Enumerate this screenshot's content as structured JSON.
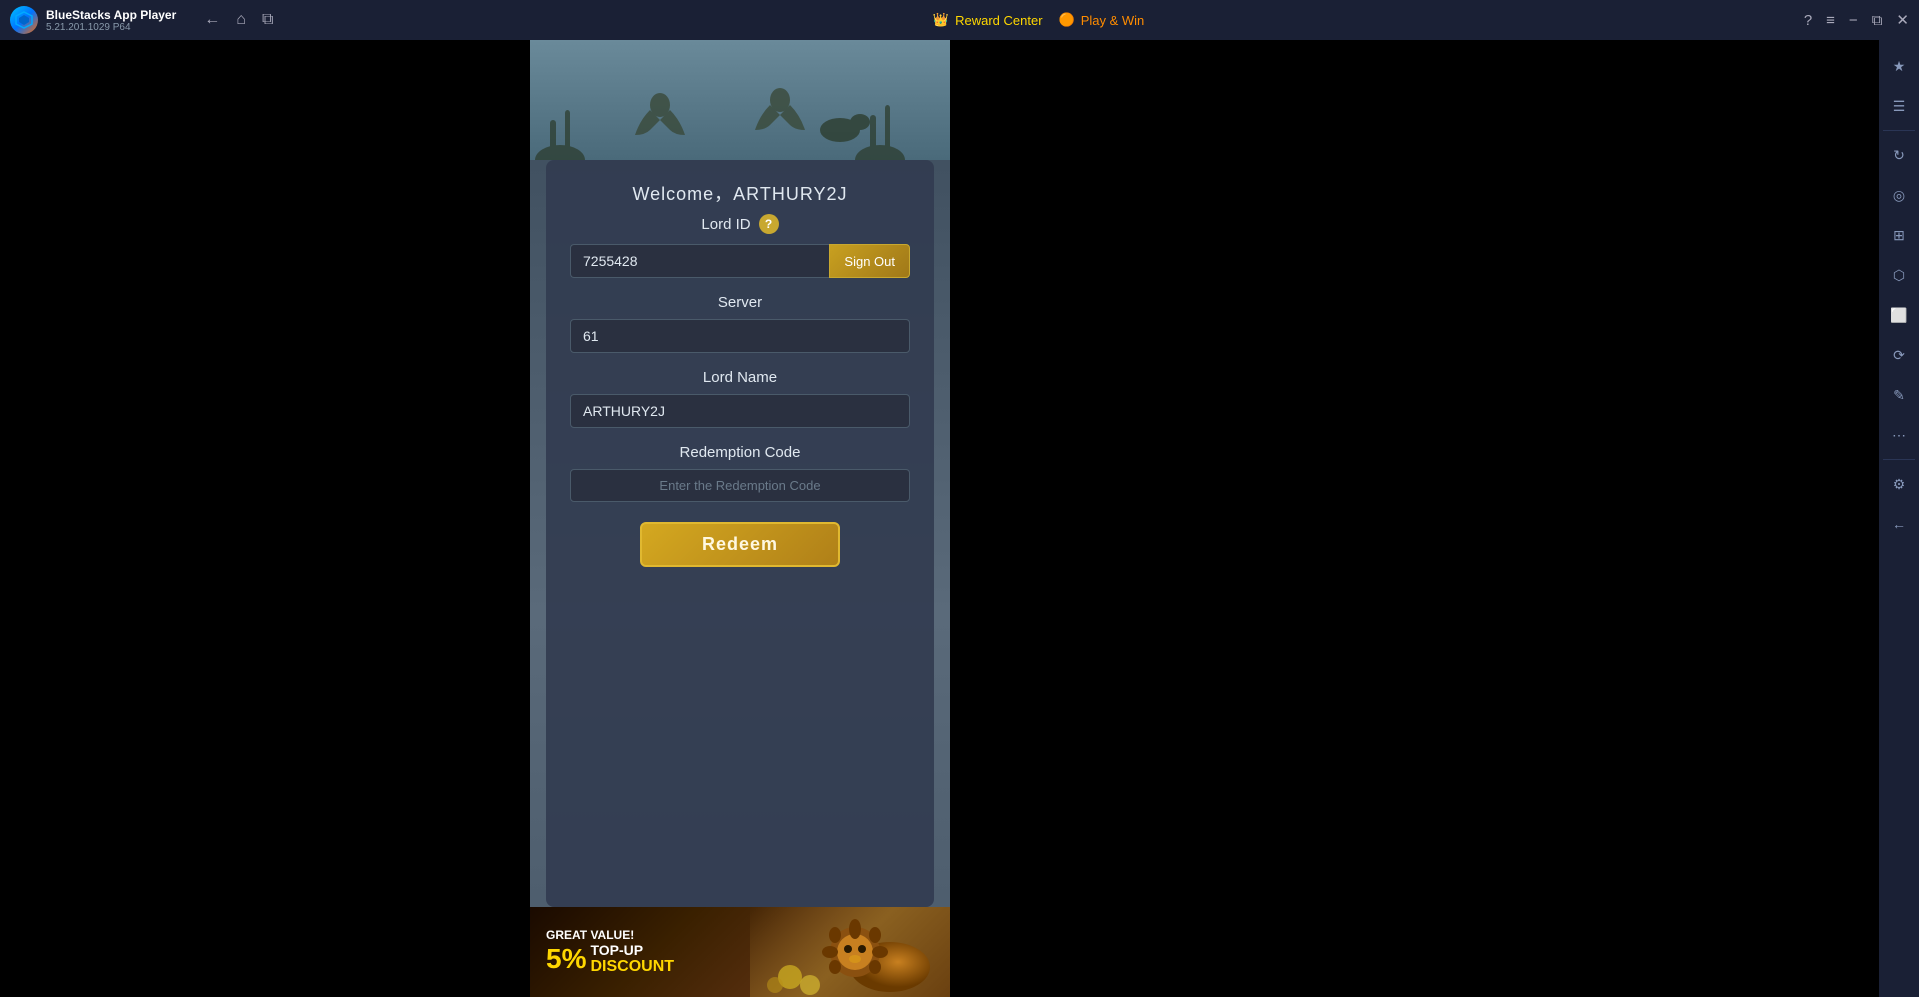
{
  "titleBar": {
    "appName": "BlueStacks App Player",
    "version": "5.21.201.1029  P64",
    "rewardCenter": "Reward Center",
    "playWin": "Play & Win",
    "backBtn": "←",
    "homeBtn": "⌂",
    "multiBtn": "⧉"
  },
  "windowControls": {
    "help": "?",
    "menu": "≡",
    "minimize": "−",
    "restore": "⧉",
    "close": "✕"
  },
  "game": {
    "welcomeText": "Welcome，ARTHURY2J",
    "lordIdLabel": "Lord ID",
    "lordIdValue": "7255428",
    "signOutLabel": "Sign Out",
    "serverLabel": "Server",
    "serverValue": "61",
    "lordNameLabel": "Lord Name",
    "lordNameValue": "ARTHURY2J",
    "redemptionCodeLabel": "Redemption Code",
    "redemptionCodePlaceholder": "Enter the Redemption Code",
    "redeemLabel": "Redeem"
  },
  "banner": {
    "greatValue": "GREAT VALUE!",
    "percent": "5%",
    "topUp": "TOP-UP",
    "discount": "DISCOUNT"
  },
  "sidebar": {
    "icons": [
      "★",
      "☰",
      "↻",
      "◎",
      "⊞",
      "⬡",
      "⬜",
      "✎",
      "⋯",
      "⚙",
      "←"
    ]
  }
}
